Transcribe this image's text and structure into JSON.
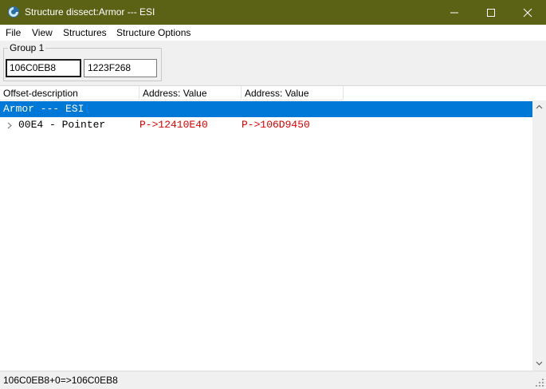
{
  "window": {
    "title": "Structure dissect:Armor --- ESI",
    "icon": "cheat-engine-icon",
    "controls": [
      "minimize-icon",
      "maximize-icon",
      "close-icon"
    ],
    "titlebar_color": "#5b6216"
  },
  "menu": {
    "items": [
      {
        "label": "File"
      },
      {
        "label": "View"
      },
      {
        "label": "Structures"
      },
      {
        "label": "Structure Options"
      }
    ]
  },
  "group": {
    "label": "Group 1",
    "addresses": [
      "106C0EB8",
      "1223F268"
    ]
  },
  "tree": {
    "columns": [
      "Offset-description",
      "Address: Value",
      "Address: Value"
    ],
    "selected_row": {
      "label": "Armor --- ESI"
    },
    "rows": [
      {
        "offset_description": "00E4 - Pointer",
        "values": [
          "P->12410E40",
          "P->106D9450"
        ]
      }
    ],
    "selection_color": "#0078d7",
    "pointer_color": "#e00000"
  },
  "status": {
    "text": "106C0EB8+0=>106C0EB8"
  }
}
